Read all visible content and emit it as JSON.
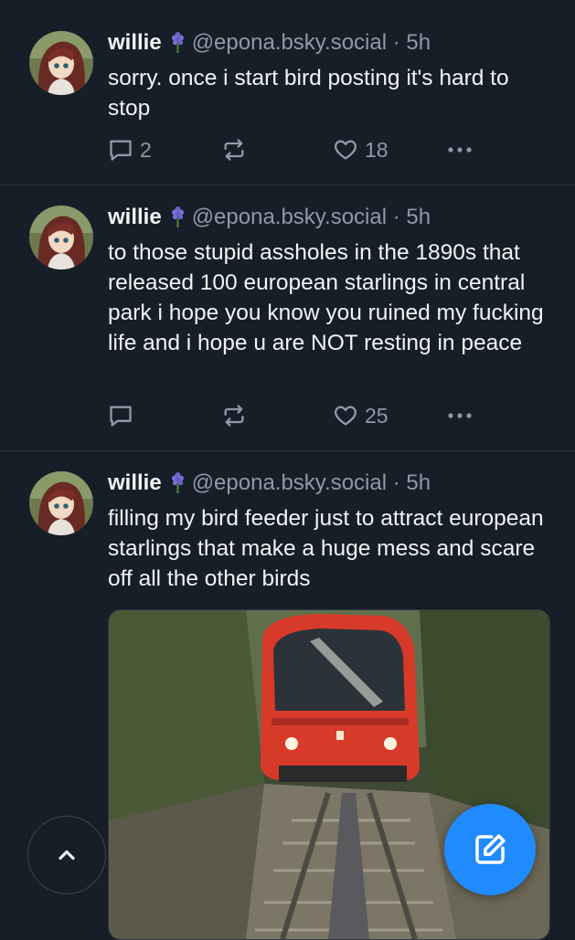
{
  "posts": [
    {
      "author": "willie",
      "handle": "@epona.bsky.social",
      "time": "5h",
      "text": "sorry. once i start bird posting it's hard to stop",
      "replies": "2",
      "reposts": "",
      "likes": "18"
    },
    {
      "author": "willie",
      "handle": "@epona.bsky.social",
      "time": "5h",
      "text": "to those stupid assholes in the 1890s that released 100 european starlings in central park i hope you know you ruined my fucking life and i hope u are NOT resting in peace",
      "replies": "",
      "reposts": "",
      "likes": "25"
    },
    {
      "author": "willie",
      "handle": "@epona.bsky.social",
      "time": "5h",
      "text": "filling my bird feeder just to attract european starlings that make a huge mess and scare off all the other birds",
      "image": "red-funicular-train-photo"
    }
  ],
  "separator": "·",
  "icons": {
    "reply": "reply-icon",
    "repost": "repost-icon",
    "like": "heart-icon",
    "more": "more-icon",
    "flower": "hyacinth-icon",
    "scroll_top": "chevron-up-icon",
    "compose": "compose-icon"
  },
  "colors": {
    "background": "#161e27",
    "text": "#f1f3f5",
    "muted": "#8e9aa8",
    "accent": "#208bfe"
  }
}
